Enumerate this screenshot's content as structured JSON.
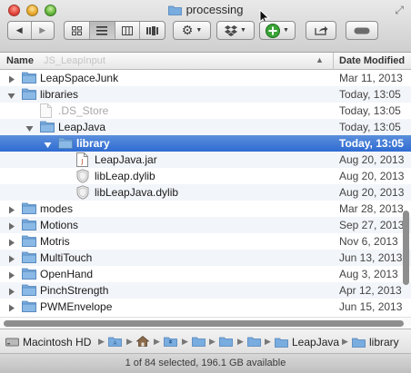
{
  "window": {
    "title": "processing"
  },
  "columns": {
    "name": "Name",
    "ghost": "JS_LeapInput",
    "date": "Date Modified"
  },
  "rows": [
    {
      "name": "LeapSpaceJunk",
      "date": "Mar 11, 2013",
      "kind": "folder",
      "level": 0,
      "disclosure": "closed"
    },
    {
      "name": "libraries",
      "date": "Today, 13:05",
      "kind": "folder",
      "level": 0,
      "disclosure": "open"
    },
    {
      "name": ".DS_Store",
      "date": "Today, 13:05",
      "kind": "file-dim",
      "level": 1,
      "disclosure": "none"
    },
    {
      "name": "LeapJava",
      "date": "Today, 13:05",
      "kind": "folder",
      "level": 1,
      "disclosure": "open"
    },
    {
      "name": "library",
      "date": "Today, 13:05",
      "kind": "folder",
      "level": 2,
      "disclosure": "open",
      "selected": true
    },
    {
      "name": "LeapJava.jar",
      "date": "Aug 20, 2013",
      "kind": "jar",
      "level": 3,
      "disclosure": "none"
    },
    {
      "name": "libLeap.dylib",
      "date": "Aug 20, 2013",
      "kind": "dylib",
      "level": 3,
      "disclosure": "none"
    },
    {
      "name": "libLeapJava.dylib",
      "date": "Aug 20, 2013",
      "kind": "dylib",
      "level": 3,
      "disclosure": "none"
    },
    {
      "name": "modes",
      "date": "Mar 28, 2013",
      "kind": "folder",
      "level": 0,
      "disclosure": "closed"
    },
    {
      "name": "Motions",
      "date": "Sep 27, 2013",
      "kind": "folder",
      "level": 0,
      "disclosure": "closed"
    },
    {
      "name": "Motris",
      "date": "Nov 6, 2013",
      "kind": "folder",
      "level": 0,
      "disclosure": "closed"
    },
    {
      "name": "MultiTouch",
      "date": "Jun 13, 2013",
      "kind": "folder",
      "level": 0,
      "disclosure": "closed"
    },
    {
      "name": "OpenHand",
      "date": "Aug 3, 2013",
      "kind": "folder",
      "level": 0,
      "disclosure": "closed"
    },
    {
      "name": "PinchStrength",
      "date": "Apr 12, 2013",
      "kind": "folder",
      "level": 0,
      "disclosure": "closed"
    },
    {
      "name": "PWMEnvelope",
      "date": "Jun 15, 2013",
      "kind": "folder",
      "level": 0,
      "disclosure": "closed"
    }
  ],
  "pathbar": {
    "disk": "Macintosh HD",
    "crumb1": "LeapJava",
    "crumb2": "library"
  },
  "status": {
    "text": "1 of 84 selected, 196.1 GB available"
  },
  "colors": {
    "selection": "#3a75d6",
    "folder": "#6fa6dc"
  }
}
